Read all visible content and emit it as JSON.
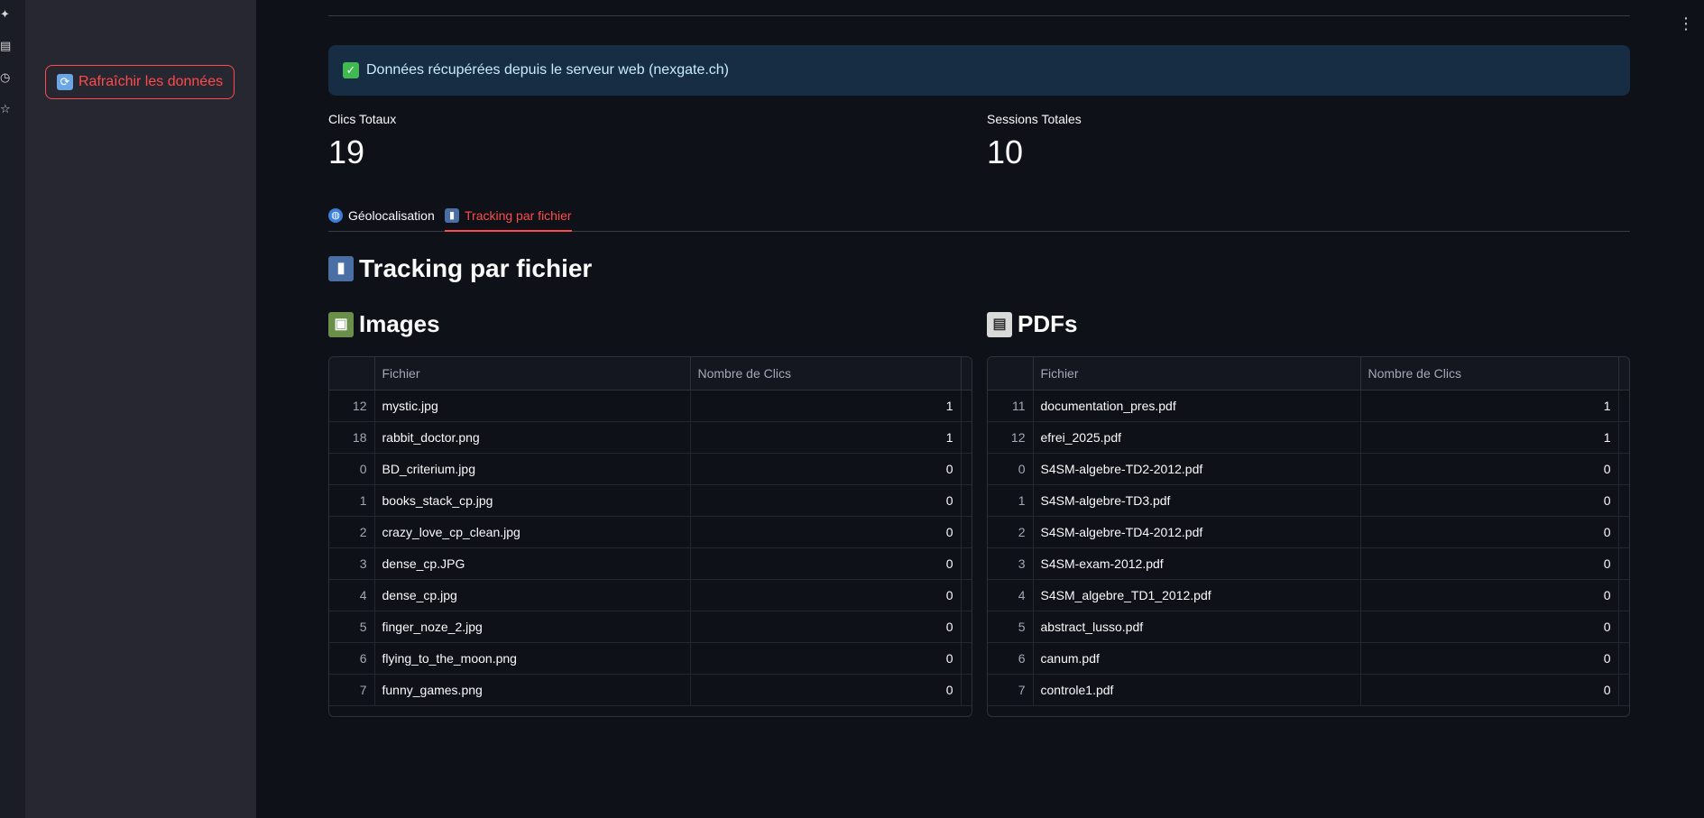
{
  "sidebar": {
    "refresh_label": "Rafraîchir les données"
  },
  "alert": {
    "text": "Données récupérées depuis le serveur web (nexgate.ch)"
  },
  "metrics": [
    {
      "label": "Clics Totaux",
      "value": "19"
    },
    {
      "label": "Sessions Totales",
      "value": "10"
    }
  ],
  "tabs": [
    {
      "label": "Géolocalisation",
      "icon": "globe-icon",
      "active": false
    },
    {
      "label": "Tracking par fichier",
      "icon": "bar-chart-icon",
      "active": true
    }
  ],
  "section_title": "Tracking par fichier",
  "images": {
    "title": "Images",
    "columns": [
      "Fichier",
      "Nombre de Clics"
    ],
    "rows": [
      [
        "12",
        "mystic.jpg",
        "1"
      ],
      [
        "18",
        "rabbit_doctor.png",
        "1"
      ],
      [
        "0",
        "BD_criterium.jpg",
        "0"
      ],
      [
        "1",
        "books_stack_cp.jpg",
        "0"
      ],
      [
        "2",
        "crazy_love_cp_clean.jpg",
        "0"
      ],
      [
        "3",
        "dense_cp.JPG",
        "0"
      ],
      [
        "4",
        "dense_cp.jpg",
        "0"
      ],
      [
        "5",
        "finger_noze_2.jpg",
        "0"
      ],
      [
        "6",
        "flying_to_the_moon.png",
        "0"
      ],
      [
        "7",
        "funny_games.png",
        "0"
      ]
    ]
  },
  "pdfs": {
    "title": "PDFs",
    "columns": [
      "Fichier",
      "Nombre de Clics"
    ],
    "rows": [
      [
        "11",
        "documentation_pres.pdf",
        "1"
      ],
      [
        "12",
        "efrei_2025.pdf",
        "1"
      ],
      [
        "0",
        "S4SM-algebre-TD2-2012.pdf",
        "0"
      ],
      [
        "1",
        "S4SM-algebre-TD3.pdf",
        "0"
      ],
      [
        "2",
        "S4SM-algebre-TD4-2012.pdf",
        "0"
      ],
      [
        "3",
        "S4SM-exam-2012.pdf",
        "0"
      ],
      [
        "4",
        "S4SM_algebre_TD1_2012.pdf",
        "0"
      ],
      [
        "5",
        "abstract_lusso.pdf",
        "0"
      ],
      [
        "6",
        "canum.pdf",
        "0"
      ],
      [
        "7",
        "controle1.pdf",
        "0"
      ]
    ]
  },
  "colors": {
    "accent": "#ff4b4b",
    "info_bg": "#172d43",
    "info_text": "#c7ebff",
    "background": "#0e1117",
    "sidebar": "#262730"
  }
}
